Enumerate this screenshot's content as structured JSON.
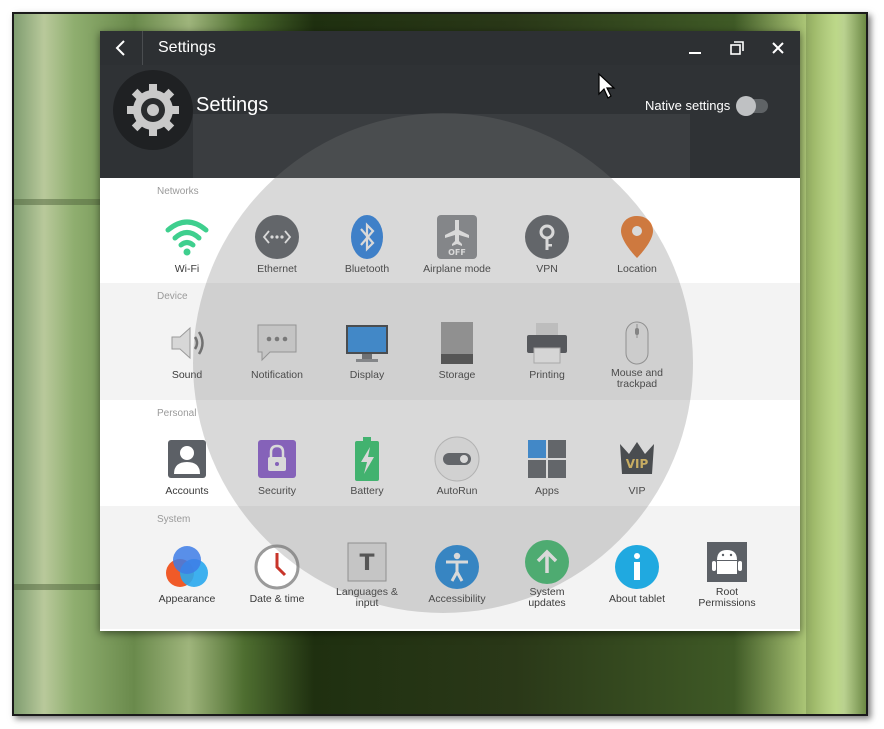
{
  "window": {
    "title": "Settings"
  },
  "header": {
    "title": "Settings",
    "native_label": "Native settings",
    "native_enabled": false
  },
  "sections": [
    {
      "label": "Networks",
      "items": [
        {
          "label": "Wi-Fi",
          "icon": "wifi-icon"
        },
        {
          "label": "Ethernet",
          "icon": "ethernet-icon"
        },
        {
          "label": "Bluetooth",
          "icon": "bluetooth-icon"
        },
        {
          "label": "Airplane mode",
          "icon": "airplane-icon",
          "badge": "OFF"
        },
        {
          "label": "VPN",
          "icon": "vpn-key-icon"
        },
        {
          "label": "Location",
          "icon": "location-pin-icon"
        }
      ]
    },
    {
      "label": "Device",
      "items": [
        {
          "label": "Sound",
          "icon": "speaker-icon"
        },
        {
          "label": "Notification",
          "icon": "notification-bubble-icon"
        },
        {
          "label": "Display",
          "icon": "monitor-icon"
        },
        {
          "label": "Storage",
          "icon": "storage-icon"
        },
        {
          "label": "Printing",
          "icon": "printer-icon"
        },
        {
          "label": "Mouse and trackpad",
          "label_line1": "Mouse and",
          "label_line2": "trackpad",
          "icon": "mouse-icon"
        }
      ]
    },
    {
      "label": "Personal",
      "items": [
        {
          "label": "Accounts",
          "icon": "account-icon"
        },
        {
          "label": "Security",
          "icon": "lock-icon"
        },
        {
          "label": "Battery",
          "icon": "battery-icon"
        },
        {
          "label": "AutoRun",
          "icon": "toggle-icon"
        },
        {
          "label": "Apps",
          "icon": "apps-grid-icon"
        },
        {
          "label": "VIP",
          "icon": "vip-crown-icon",
          "badge": "VIP"
        }
      ]
    },
    {
      "label": "System",
      "items": [
        {
          "label": "Appearance",
          "icon": "appearance-circles-icon"
        },
        {
          "label": "Date & time",
          "icon": "clock-icon"
        },
        {
          "label": "Languages & input",
          "label_line1": "Languages &",
          "label_line2": "input",
          "icon": "keyboard-t-icon",
          "badge": "T"
        },
        {
          "label": "Accessibility",
          "icon": "accessibility-icon"
        },
        {
          "label": "System updates",
          "label_line1": "System",
          "label_line2": "updates",
          "icon": "update-arrow-icon"
        },
        {
          "label": "About tablet",
          "icon": "info-icon"
        },
        {
          "label": "Root Permissions",
          "label_line1": "Root",
          "label_line2": "Permissions",
          "icon": "android-icon"
        }
      ]
    }
  ],
  "colors": {
    "titlebar": "#2d3033",
    "header": "#2f3235",
    "wifi": "#3ecf8e",
    "bluetooth": "#2a84e8",
    "location": "#f07a2a",
    "security": "#8b5bd3",
    "battery": "#2fca6c",
    "accessibility": "#1f8be0",
    "updates": "#3fbf70",
    "info": "#20a9e0"
  }
}
